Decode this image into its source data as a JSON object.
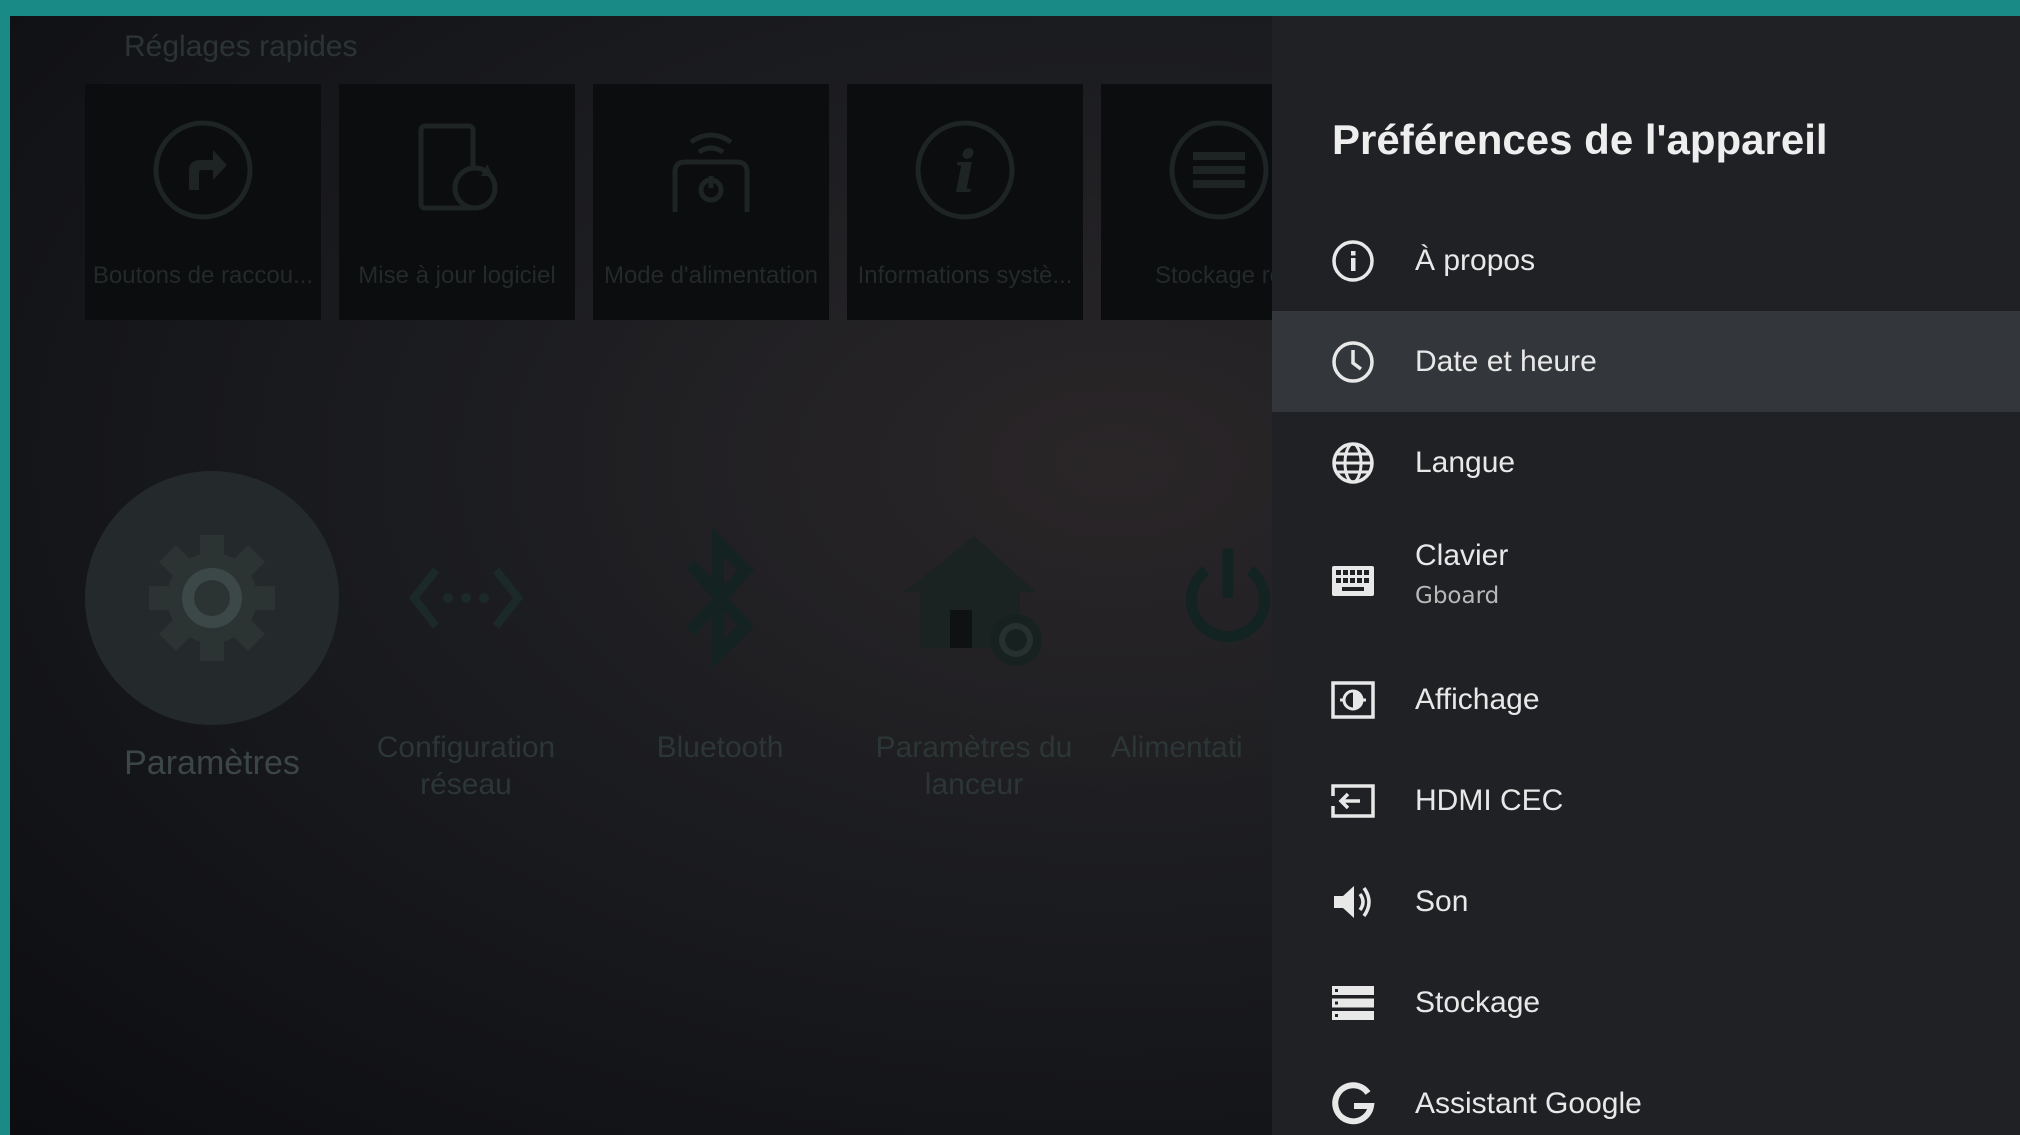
{
  "background": {
    "quick_settings_title": "Réglages rapides",
    "quick_tiles": [
      {
        "label": "Boutons de raccou...",
        "icon": "shortcut-icon"
      },
      {
        "label": "Mise à jour logiciel",
        "icon": "update-icon"
      },
      {
        "label": "Mode d'alimentation",
        "icon": "power-mode-icon"
      },
      {
        "label": "Informations systè...",
        "icon": "info-icon"
      },
      {
        "label": "Stockage ré",
        "icon": "storage-icon"
      }
    ],
    "apps": [
      {
        "label": "Paramètres",
        "icon": "gear-icon"
      },
      {
        "label": "Configuration réseau",
        "icon": "network-icon"
      },
      {
        "label": "Bluetooth",
        "icon": "bluetooth-icon"
      },
      {
        "label": "Paramètres du lanceur",
        "icon": "launcher-settings-icon"
      },
      {
        "label": "Alimentati",
        "icon": "power-icon"
      }
    ]
  },
  "panel": {
    "title": "Préférences de l'appareil",
    "items": [
      {
        "label": "À propos",
        "icon": "info-circle-icon"
      },
      {
        "label": "Date et heure",
        "icon": "clock-icon",
        "selected": true
      },
      {
        "label": "Langue",
        "icon": "globe-icon"
      },
      {
        "label": "Clavier",
        "sublabel": "Gboard",
        "icon": "keyboard-icon"
      },
      {
        "label": "Affichage",
        "icon": "display-icon"
      },
      {
        "label": "HDMI CEC",
        "icon": "hdmi-input-icon"
      },
      {
        "label": "Son",
        "icon": "speaker-icon"
      },
      {
        "label": "Stockage",
        "icon": "storage-list-icon"
      },
      {
        "label": "Assistant Google",
        "icon": "google-g-icon"
      }
    ]
  },
  "colors": {
    "frame": "#1a8a86",
    "panel_bg": "#202124",
    "selected_bg": "#33363a",
    "text": "#e8e8e8"
  }
}
